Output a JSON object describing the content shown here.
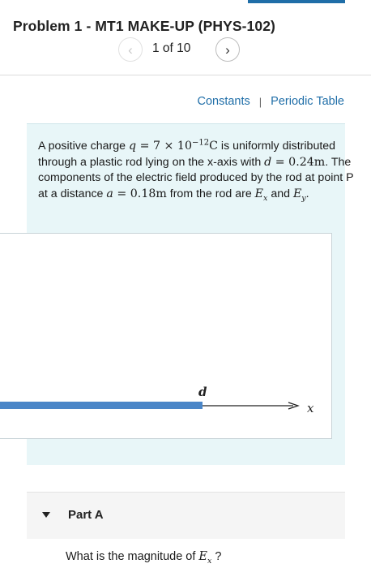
{
  "header": {
    "title": "Problem 1 - MT1 MAKE-UP (PHYS-102)",
    "counter": "1 of 10",
    "prev_icon": "chevron-left-icon",
    "next_icon": "chevron-right-icon"
  },
  "resources": {
    "constants": "Constants",
    "separator": "|",
    "periodic_table": "Periodic Table"
  },
  "problem": {
    "t1": "A positive charge ",
    "q_var": "q",
    "eq1": " = 7 × 10",
    "q_exp": "−12",
    "q_unit": "C",
    "t2": " is uniformly distributed through a plastic rod lying on the x-axis with ",
    "d_var": "d",
    "d_val": " = 0.24m",
    "t3": ". The components of the electric field produced by the rod at point P at a distance ",
    "a_var": "a",
    "a_val": " = 0.18m",
    "t4": " from the rod are ",
    "E": "E",
    "x_sub": "x",
    "and": " and ",
    "y_sub": "y",
    "period": "."
  },
  "figure": {
    "rod_label": "d",
    "axis_label": "x",
    "rod_color": "#4a86c8"
  },
  "part": {
    "label": "Part A",
    "question_pre": "What is the magnitude of ",
    "question_var": "E",
    "question_sub": "x",
    "question_post": " ?"
  },
  "colors": {
    "link": "#1f6ea8",
    "problem_bg": "#e8f6f8",
    "accent": "#1f6ea8"
  }
}
